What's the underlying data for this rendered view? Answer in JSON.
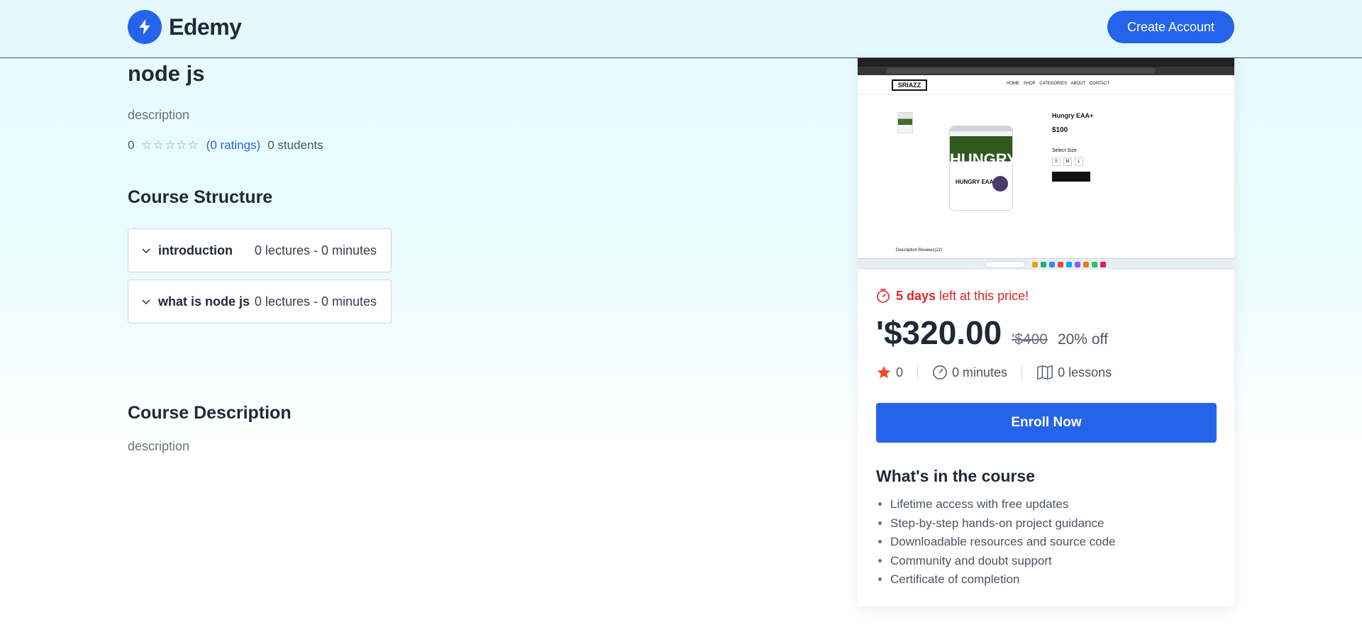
{
  "header": {
    "logo_text": "Edemy",
    "create_account_label": "Create Account"
  },
  "course": {
    "title": "node js",
    "description": "description",
    "rating_value": "0",
    "stars": "☆☆☆☆☆",
    "ratings_text": "(0 ratings)",
    "students_text": "0 students"
  },
  "structure": {
    "heading": "Course Structure",
    "chapters": [
      {
        "title": "introduction",
        "meta": "0 lectures - 0 minutes"
      },
      {
        "title": "what is node js",
        "meta": "0 lectures - 0 minutes"
      }
    ]
  },
  "course_description": {
    "heading": "Course Description",
    "body": "description"
  },
  "sidebar": {
    "preview": {
      "brand": "SRIAZZ",
      "nav_links": "HOME SHOP CATEGORIES ABOUT CONTACT",
      "product_name": "Hungry EAA+",
      "product_price": "$100",
      "tub_text": "HUNGRY",
      "tub_sub": "HUNGRY EAA+",
      "select_size": "Select Size",
      "sizes": [
        "S",
        "M",
        "L"
      ],
      "tabs": "Description     Reviews(22)"
    },
    "deal_days": "5 days",
    "deal_rest": " left at this price!",
    "price": "'$320.00",
    "old_price": "'$400",
    "discount": "20% off",
    "rating": "0",
    "duration": "0 minutes",
    "lessons": "0 lessons",
    "enroll_label": "Enroll Now",
    "whats_in_heading": "What's in the course",
    "features": [
      "Lifetime access with free updates",
      "Step-by-step hands-on project guidance",
      "Downloadable resources and source code",
      "Community and doubt support",
      "Certificate of completion"
    ]
  },
  "colors": {
    "accent": "#2563eb",
    "deal_red": "#dc2626",
    "star_orange": "#f04a23"
  }
}
